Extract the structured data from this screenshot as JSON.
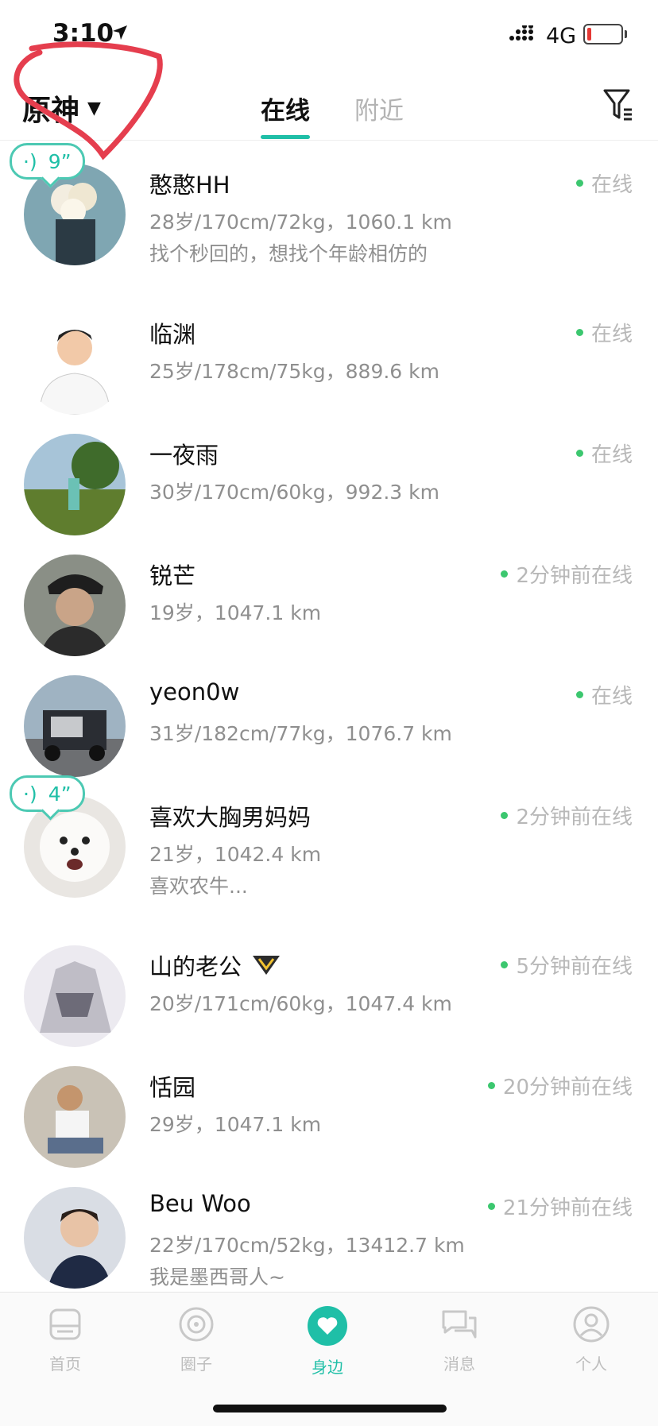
{
  "status_bar": {
    "time": "3:10",
    "network": "4G"
  },
  "header": {
    "game_selector": "原神",
    "tabs": [
      {
        "label": "在线",
        "active": true
      },
      {
        "label": "附近",
        "active": false
      }
    ]
  },
  "colors": {
    "accent": "#1fbfa7",
    "online_dot": "#3cc76f",
    "muted": "#8f8f8f"
  },
  "users": [
    {
      "name": "憨憨HH",
      "stats": "28岁/170cm/72kg，1060.1 km",
      "bio": "找个秒回的，想找个年龄相仿的",
      "status": "在线",
      "voice": "9”"
    },
    {
      "name": "临渊",
      "stats": "25岁/178cm/75kg，889.6 km",
      "bio": "",
      "status": "在线"
    },
    {
      "name": "一夜雨",
      "stats": "30岁/170cm/60kg，992.3 km",
      "bio": "",
      "status": "在线"
    },
    {
      "name": "锐芒",
      "stats": "19岁，1047.1 km",
      "bio": "",
      "status": "2分钟前在线"
    },
    {
      "name": "yeon0w",
      "stats": "31岁/182cm/77kg，1076.7 km",
      "bio": "",
      "status": "在线"
    },
    {
      "name": "喜欢大胸男妈妈",
      "stats": "21岁，1042.4 km",
      "bio": "喜欢农牛...",
      "status": "2分钟前在线",
      "voice": "4”"
    },
    {
      "name": "山的老公",
      "stats": "20岁/171cm/60kg，1047.4 km",
      "bio": "",
      "status": "5分钟前在线",
      "vip": true
    },
    {
      "name": "恬园",
      "stats": "29岁，1047.1 km",
      "bio": "",
      "status": "20分钟前在线"
    },
    {
      "name": "Beu Woo",
      "stats": "22岁/170cm/52kg，13412.7 km",
      "bio": "我是墨西哥人~",
      "status": "21分钟前在线"
    }
  ],
  "tabbar": [
    {
      "label": "首页",
      "icon": "home-icon"
    },
    {
      "label": "圈子",
      "icon": "circle-icon"
    },
    {
      "label": "身边",
      "icon": "heart-icon",
      "active": true
    },
    {
      "label": "消息",
      "icon": "chat-icon"
    },
    {
      "label": "个人",
      "icon": "person-icon"
    }
  ]
}
